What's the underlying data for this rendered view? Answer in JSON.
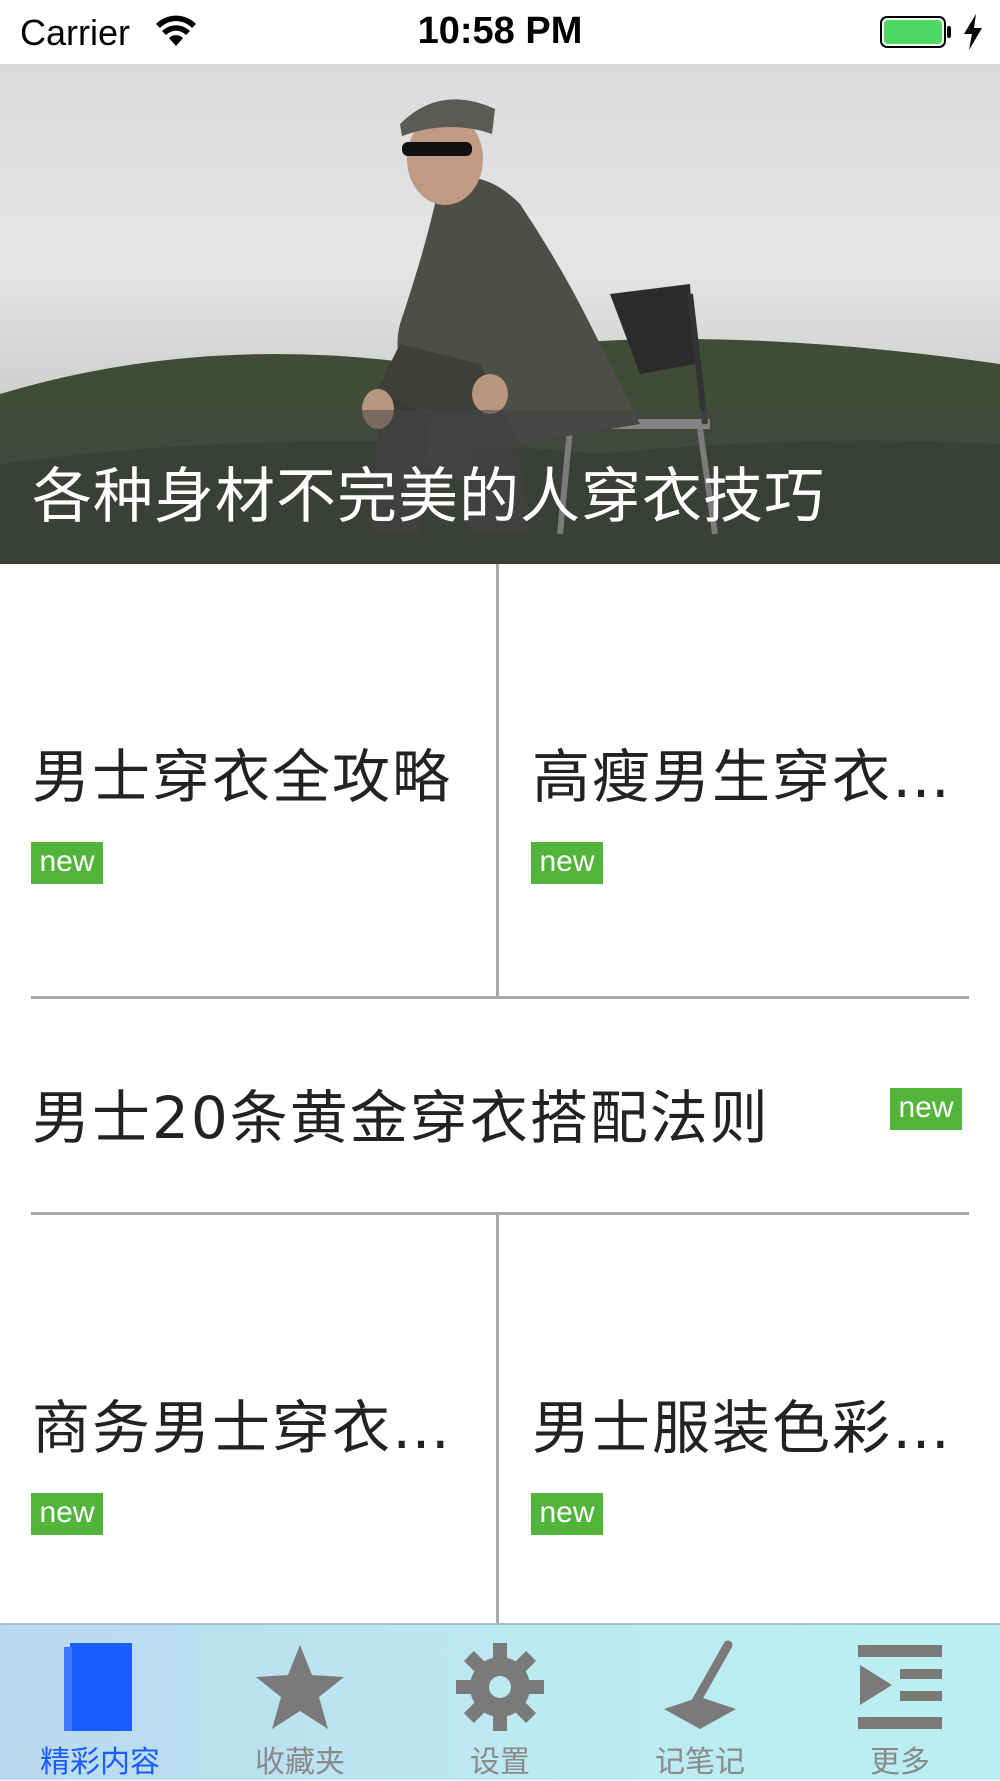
{
  "status_bar": {
    "carrier": "Carrier",
    "time": "10:58 PM"
  },
  "hero": {
    "title": "各种身材不完美的人穿衣技巧"
  },
  "articles": [
    {
      "title": "男士穿衣全攻略",
      "badge": "new"
    },
    {
      "title": "高瘦男生穿衣…",
      "badge": "new"
    },
    {
      "title": "男士20条黄金穿衣搭配法则",
      "badge": "new"
    },
    {
      "title": "商务男士穿衣…",
      "badge": "new"
    },
    {
      "title": "男士服装色彩…",
      "badge": "new"
    }
  ],
  "tab_bar": {
    "tabs": [
      {
        "label": "精彩内容",
        "icon": "book-icon",
        "active": true
      },
      {
        "label": "收藏夹",
        "icon": "star-icon",
        "active": false
      },
      {
        "label": "设置",
        "icon": "gear-icon",
        "active": false
      },
      {
        "label": "记笔记",
        "icon": "pen-icon",
        "active": false
      },
      {
        "label": "更多",
        "icon": "more-icon",
        "active": false
      }
    ]
  },
  "colors": {
    "badge": "#53b43c",
    "active_tab": "#1a5cff",
    "inactive_tab": "#8a8a8a",
    "battery": "#4cd964"
  }
}
